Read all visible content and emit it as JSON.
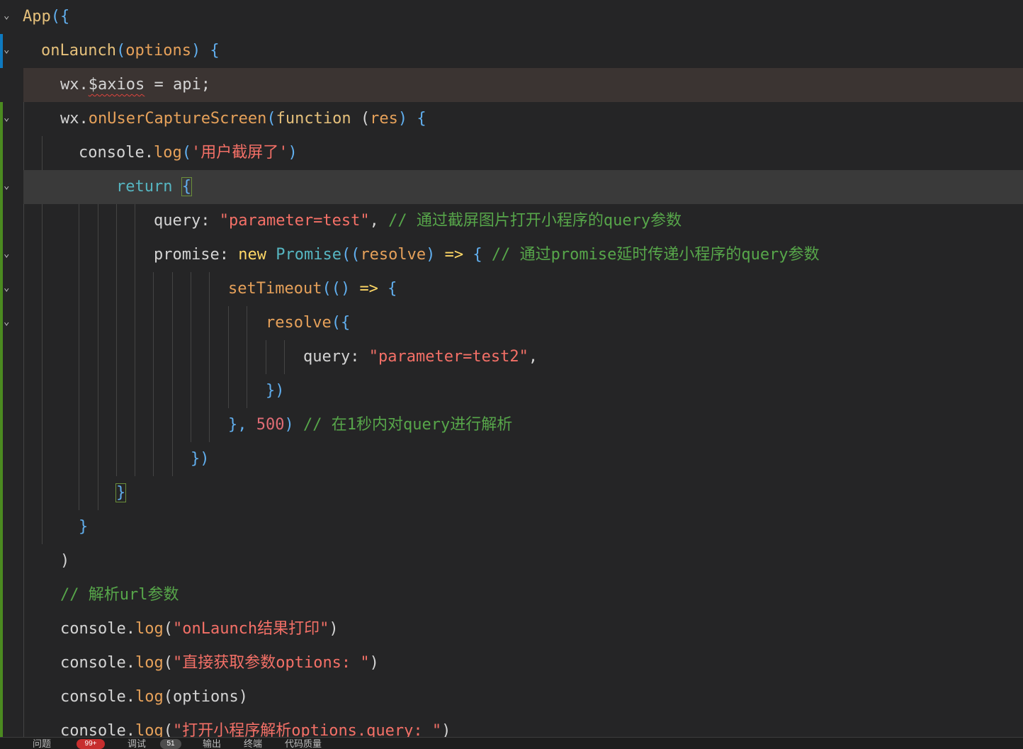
{
  "colors": {
    "background": "#252526",
    "gutter_blue": "#0e7ac0",
    "gutter_green": "#4b8b20",
    "error_badge": "#c72e2e"
  },
  "editor": {
    "lines": [
      {
        "tokens": [
          "App",
          "({"
        ]
      },
      {
        "tokens": [
          "onLaunch",
          "(",
          "options",
          ")",
          " {"
        ]
      },
      {
        "tokens": [
          "wx.",
          "$axios",
          " = ",
          "api;"
        ]
      },
      {
        "tokens": [
          "wx.",
          "onUserCaptureScreen",
          "(",
          "function",
          " (",
          "res",
          ") {"
        ]
      },
      {
        "tokens": [
          "console.",
          "log",
          "(",
          "'用户截屏了'",
          ")"
        ]
      },
      {
        "tokens": [
          "return",
          " ",
          "{"
        ]
      },
      {
        "tokens": [
          "query",
          ": ",
          "\"parameter=test\"",
          ", ",
          "// 通过截屏图片打开小程序的query参数"
        ]
      },
      {
        "tokens": [
          "promise",
          ": ",
          "new",
          " ",
          "Promise",
          "((",
          "resolve",
          ") ",
          "=>",
          " { ",
          "// 通过promise延时传递小程序的query参数"
        ]
      },
      {
        "tokens": [
          "setTimeout",
          "(() ",
          "=>",
          " {"
        ]
      },
      {
        "tokens": [
          "resolve",
          "({"
        ]
      },
      {
        "tokens": [
          "query",
          ": ",
          "\"parameter=test2\"",
          ","
        ]
      },
      {
        "tokens": [
          "})"
        ]
      },
      {
        "tokens": [
          "}, ",
          "500",
          ") ",
          "// 在1秒内对query进行解析"
        ]
      },
      {
        "tokens": [
          "})"
        ]
      },
      {
        "tokens": [
          "}"
        ]
      },
      {
        "tokens": [
          "}"
        ]
      },
      {
        "tokens": [
          ")"
        ]
      },
      {
        "tokens": [
          "// 解析url参数"
        ]
      },
      {
        "tokens": [
          "console.",
          "log",
          "(",
          "\"onLaunch结果打印\"",
          ")"
        ]
      },
      {
        "tokens": [
          "console.",
          "log",
          "(",
          "\"直接获取参数options: \"",
          ")"
        ]
      },
      {
        "tokens": [
          "console.",
          "log",
          "(",
          "options",
          ")"
        ]
      },
      {
        "tokens": [
          "console.",
          "log",
          "(",
          "\"打开小程序解析options.query: \"",
          ")"
        ]
      }
    ]
  },
  "panel": {
    "tabs": [
      {
        "label": "问题",
        "badge": "99+"
      },
      {
        "label": "调试",
        "badge": "51"
      },
      {
        "label": "输出"
      },
      {
        "label": "终端"
      },
      {
        "label": "代码质量"
      }
    ]
  }
}
